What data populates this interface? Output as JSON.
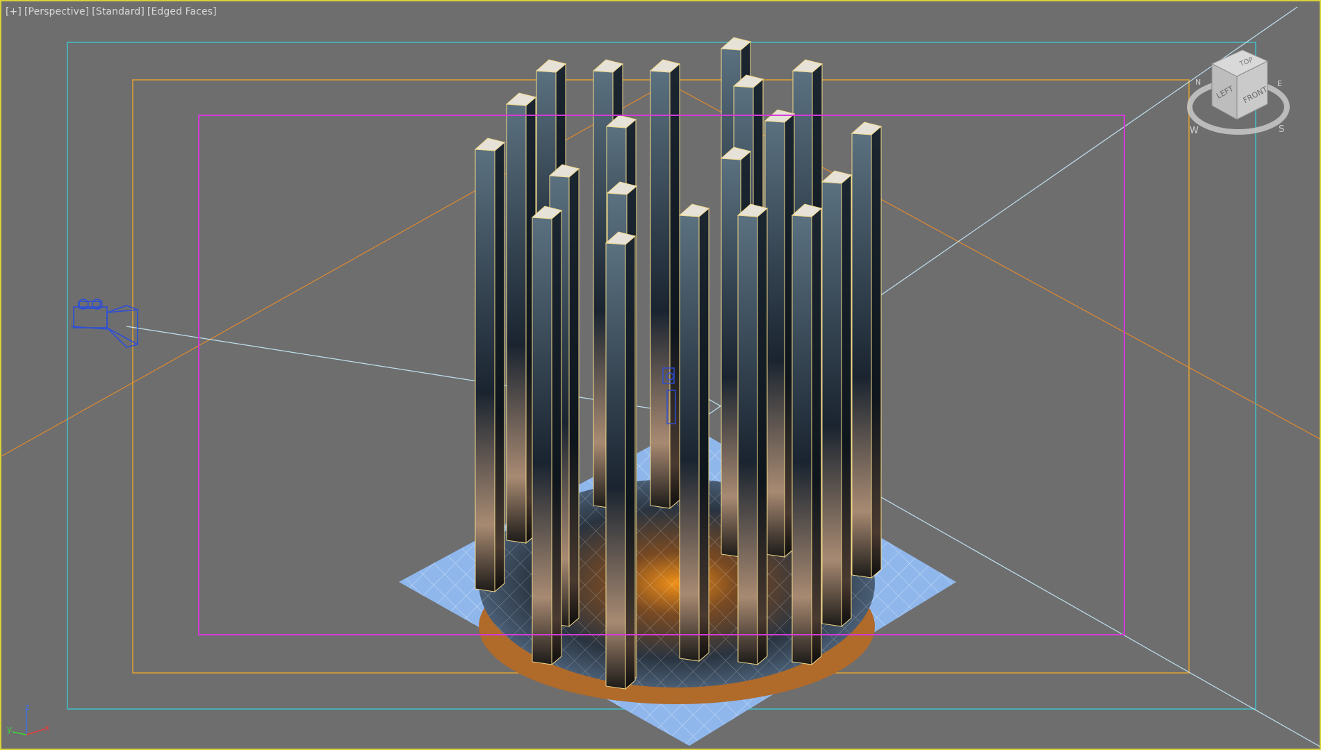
{
  "viewport": {
    "labels": {
      "menu": "[+]",
      "view": "[Perspective]",
      "shading_standard": "[Standard]",
      "shading_edges": "[Edged Faces]"
    },
    "border_color": "#d8d23a",
    "background_color": "#6e6e6e"
  },
  "viewcube": {
    "faces": {
      "top": "TOP",
      "left": "LEFT",
      "front": "FRONT"
    },
    "compass": {
      "w": "W",
      "s": "S",
      "n": "N",
      "e": "E"
    }
  },
  "axis_tripod": {
    "x": "x",
    "y": "y",
    "z": "z"
  },
  "colors": {
    "safe_frame_outer": "#3fc0c8",
    "safe_frame_action": "#e0a030",
    "safe_frame_title": "#d43ad8",
    "camera": "#2d4fd8",
    "target_line": "#bfe2f0",
    "pillar_edge": "#f2d98a",
    "pillar_cap": "#e6e2d8",
    "floor": "#8fb7ec",
    "frustum": "#e08a30"
  }
}
